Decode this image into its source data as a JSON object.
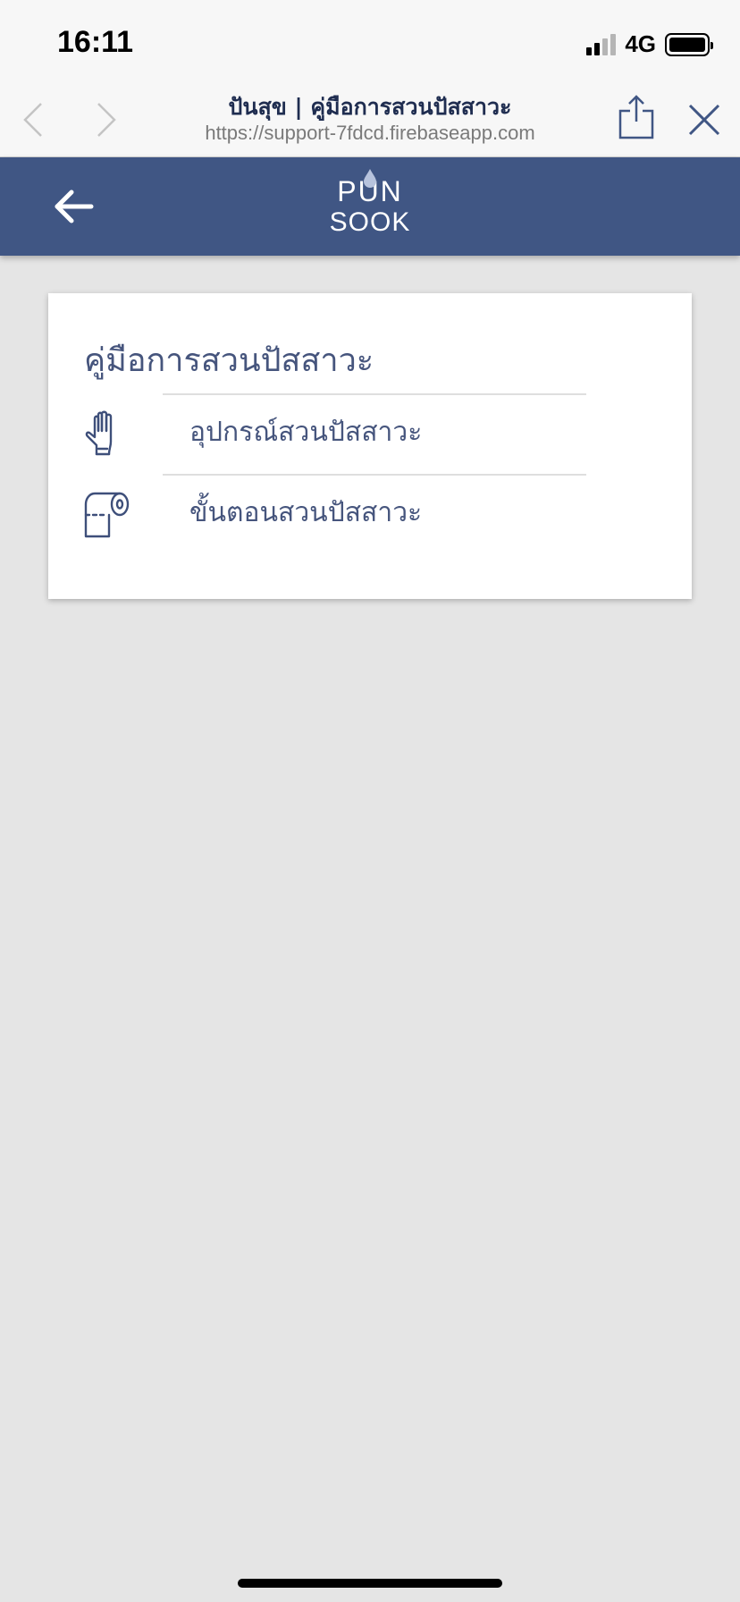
{
  "status_bar": {
    "time": "16:11",
    "network": "4G",
    "signal_bars_active": 2,
    "signal_bars_total": 4
  },
  "browser": {
    "title": "ปันสุข | คู่มือการสวนปัสสาวะ",
    "url": "https://support-7fdcd.firebaseapp.com",
    "back_icon": "chevron-left-icon",
    "forward_icon": "chevron-right-icon",
    "share_icon": "share-icon",
    "close_icon": "close-icon"
  },
  "app_header": {
    "background": "#405684",
    "back_icon": "arrow-left-icon",
    "logo_line1": "PUN",
    "logo_line2": "SOOK"
  },
  "card": {
    "title": "คู่มือการสวนปัสสาวะ",
    "items": [
      {
        "label": "อุปกรณ์สวนปัสสาวะ",
        "icon": "glove-icon"
      },
      {
        "label": "ขั้นตอนสวนปัสสาวะ",
        "icon": "toilet-paper-icon"
      }
    ]
  },
  "colors": {
    "accent": "#405684",
    "text": "#46557d",
    "page_background": "#e5e5e5"
  }
}
